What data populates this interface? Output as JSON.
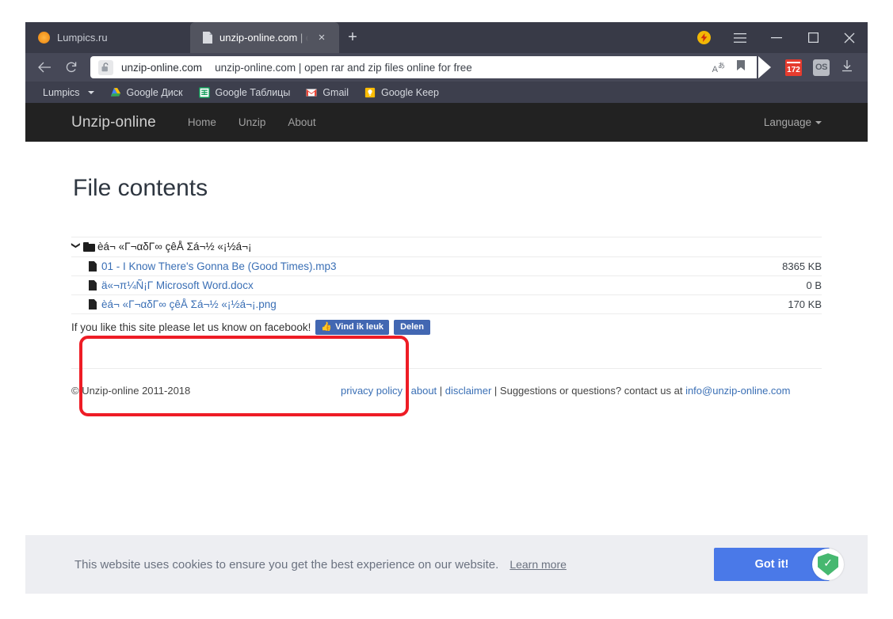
{
  "browser": {
    "tabs": [
      {
        "title": "Lumpics.ru",
        "favicon": "orange-dot-icon",
        "active": false
      },
      {
        "title": "unzip-online.com | open",
        "favicon": "document-icon",
        "active": true
      }
    ],
    "new_tab_label": "+",
    "tab_close_label": "×",
    "window_controls": {
      "turbo_label": "⚡",
      "menu_label": "☰",
      "minimize_label": "—",
      "maximize_label": "□",
      "close_label": "✕"
    },
    "toolbar": {
      "back_label": "←",
      "reload_label": "⟳",
      "lock_label": "🔓",
      "omnibox_domain": "unzip-online.com",
      "omnibox_title": "unzip-online.com | open rar and zip files online for free",
      "translate_label": "Aあ",
      "bookmark_label": "🔖",
      "ext_calendar_count": "172",
      "ext_os_label": "OS",
      "download_label": "↓"
    },
    "bookmarks": [
      {
        "label": "Lumpics",
        "icon": "folder-dropdown-icon",
        "has_caret": true
      },
      {
        "label": "Google Диск",
        "icon": "google-drive-icon",
        "has_caret": false
      },
      {
        "label": "Google Таблицы",
        "icon": "google-sheets-icon",
        "has_caret": false
      },
      {
        "label": "Gmail",
        "icon": "gmail-icon",
        "has_caret": false
      },
      {
        "label": "Google Keep",
        "icon": "google-keep-icon",
        "has_caret": false
      }
    ]
  },
  "site": {
    "brand": "Unzip-online",
    "nav": [
      {
        "label": "Home"
      },
      {
        "label": "Unzip"
      },
      {
        "label": "About"
      }
    ],
    "language_label": "Language",
    "page_title": "File contents",
    "files": {
      "folder": {
        "name": "èá¬ «Γ¬αδΓ∞ çêÅ Σá¬½ «¡½á¬¡",
        "size": "",
        "expanded": true
      },
      "items": [
        {
          "name": "01 - I Know There's Gonna Be (Good Times).mp3",
          "size": "8365 KB"
        },
        {
          "name": "ä«¬π¼Ñ¡Γ Microsoft Word.docx",
          "size": "0 B"
        },
        {
          "name": "èá¬ «Γ¬αδΓ∞ çêÅ Σá¬½ «¡½á¬¡.png",
          "size": "170 KB"
        }
      ]
    },
    "facebook": {
      "text": "If you like this site please let us know on facebook!",
      "like_label": "Vind ik leuk",
      "like_icon": "thumbs-up-icon",
      "share_label": "Delen"
    },
    "footer": {
      "copyright": "© Unzip-online 2011-2018",
      "links": [
        {
          "label": "privacy policy",
          "type": "link"
        },
        {
          "label": " | ",
          "type": "sep"
        },
        {
          "label": "about",
          "type": "link"
        },
        {
          "label": " | ",
          "type": "sep"
        },
        {
          "label": "disclaimer",
          "type": "link"
        },
        {
          "label": " | Suggestions or questions? contact us at ",
          "type": "sep"
        },
        {
          "label": "info@unzip-online.com",
          "type": "link"
        }
      ]
    },
    "cookie": {
      "message": "This website uses cookies to ensure you get the best experience on our website.",
      "learn_more": "Learn more",
      "accept_label": "Got it!",
      "badge_icon": "shield-check-icon",
      "badge_glyph": "✓"
    }
  },
  "annotation": {
    "highlight_color": "#ee1c25",
    "name": "file-list-highlight"
  }
}
